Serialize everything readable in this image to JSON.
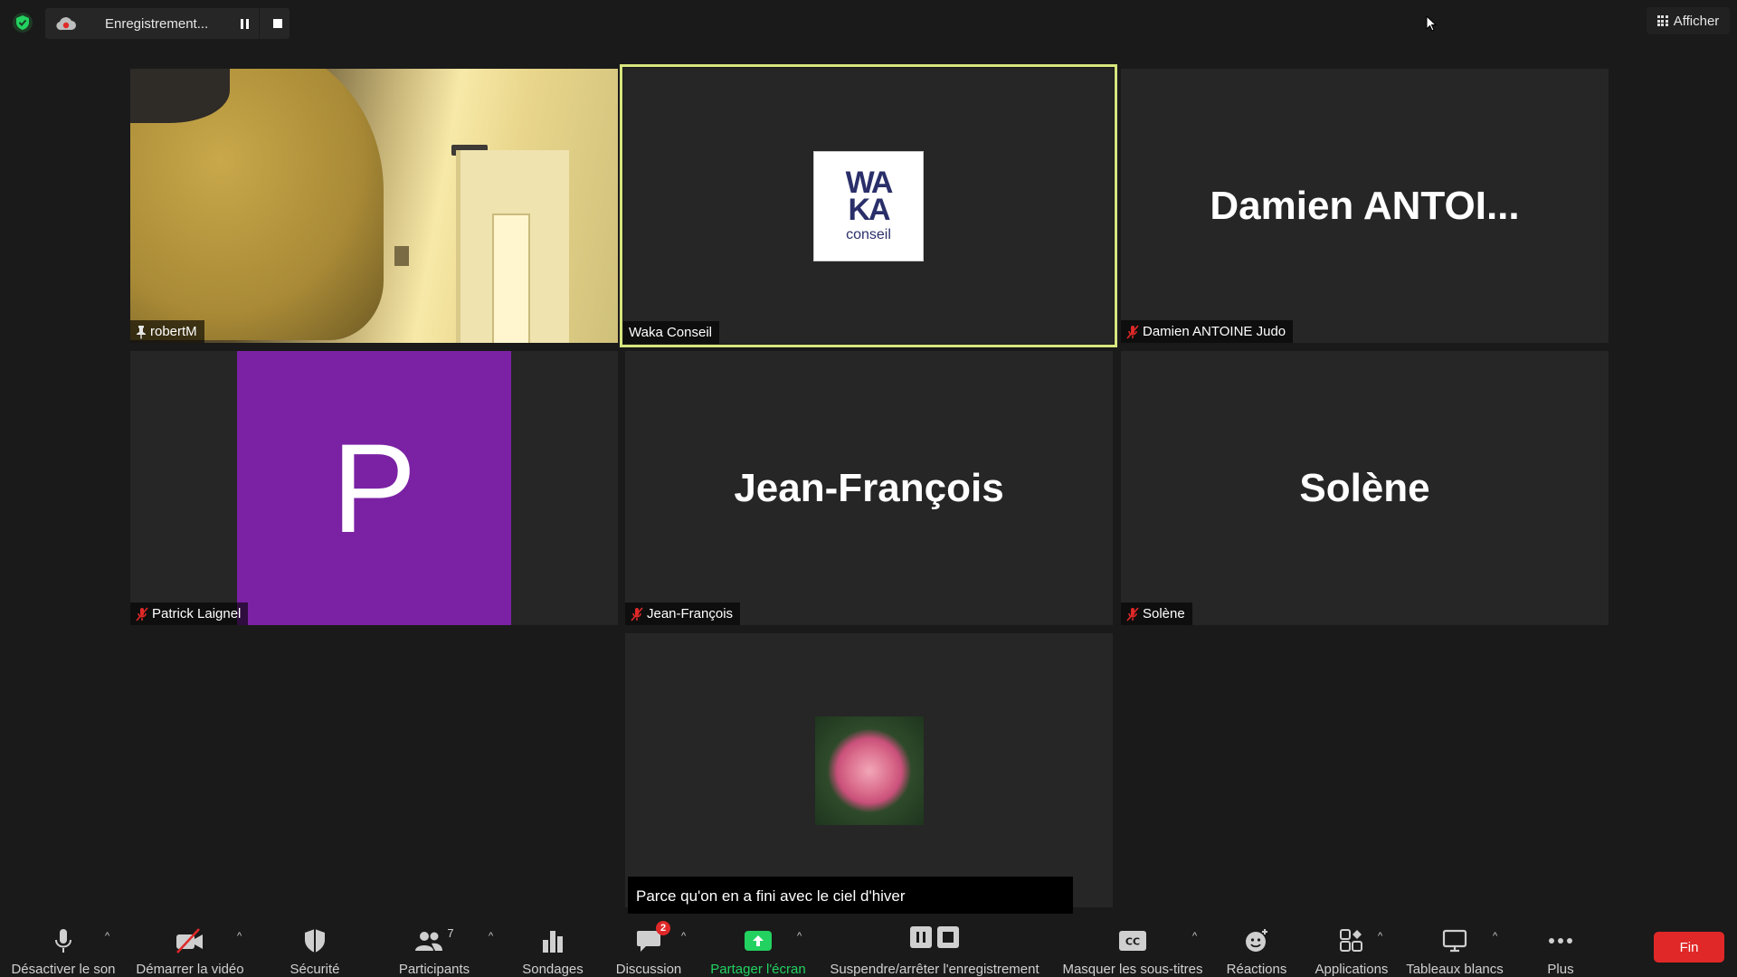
{
  "topbar": {
    "recording_label": "Enregistrement...",
    "view_label": "Afficher"
  },
  "tiles": {
    "robert": {
      "name": "robertM"
    },
    "waka": {
      "name": "Waka Conseil",
      "logo_text": "WA\nKA",
      "logo_sub": "conseil"
    },
    "damien": {
      "display_name": "Damien  ANTOI...",
      "name": "Damien ANTOINE Judo"
    },
    "patrick": {
      "avatar_letter": "P",
      "name": "Patrick Laignel"
    },
    "jf": {
      "display_name": "Jean-François",
      "name": "Jean-François"
    },
    "solene": {
      "display_name": "Solène",
      "name": "Solène"
    }
  },
  "caption": "Parce qu'on en a fini avec le ciel d'hiver",
  "toolbar": {
    "mute": "Désactiver le son",
    "video": "Démarrer la vidéo",
    "security": "Sécurité",
    "participants": "Participants",
    "participants_count": "7",
    "polls": "Sondages",
    "chat": "Discussion",
    "chat_badge": "2",
    "share": "Partager l'écran",
    "record": "Suspendre/arrêter l'enregistrement",
    "captions": "Masquer les sous-titres",
    "reactions": "Réactions",
    "apps": "Applications",
    "whiteboards": "Tableaux blancs",
    "more": "Plus",
    "end": "Fin"
  },
  "colors": {
    "active_speaker_border": "#d7e57e",
    "end_button": "#e02828",
    "share_green": "#23d160",
    "avatar_purple": "#7b22a4"
  }
}
